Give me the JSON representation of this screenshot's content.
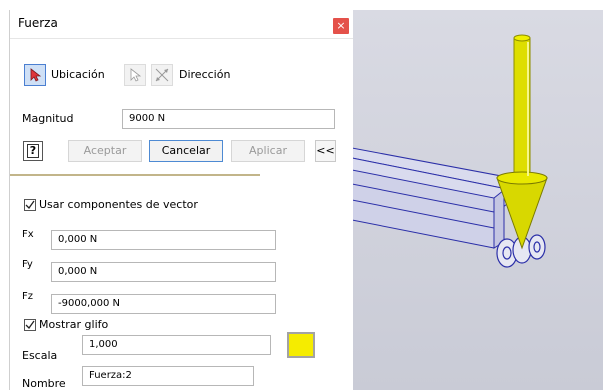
{
  "dialog": {
    "title": "Fuerza",
    "close_glyph": "×",
    "tabs": [
      {
        "label": "Ubicación",
        "icon": "select-cursor-icon",
        "active": true
      },
      {
        "label": "Dirección",
        "icon": "direction-icon",
        "active": false
      }
    ],
    "magnitude": {
      "label": "Magnitud",
      "value": "9000 N"
    },
    "buttons": {
      "help_glyph": "?",
      "ok": "Aceptar",
      "cancel": "Cancelar",
      "apply": "Aplicar",
      "collapse": "<<"
    },
    "vector": {
      "checkbox_label": "Usar componentes de vector",
      "checked": true,
      "fx": {
        "label": "Fx",
        "value": "0,000 N"
      },
      "fy": {
        "label": "Fy",
        "value": "0,000 N"
      },
      "fz": {
        "label": "Fz",
        "value": "-9000,000 N"
      }
    },
    "glyph": {
      "checkbox_label": "Mostrar glifo",
      "checked": true,
      "scale": {
        "label": "Escala",
        "value": "1,000"
      },
      "color": "#f5ec00",
      "name": {
        "label": "Nombre",
        "value": "Fuerza:2"
      }
    }
  },
  "colors": {
    "accent_blue": "#4e8ad3",
    "close_red": "#e4514a",
    "force_arrow": "#e1e100",
    "part_outline": "#2b2fa8",
    "viewport_bg": "#d3d4de"
  }
}
